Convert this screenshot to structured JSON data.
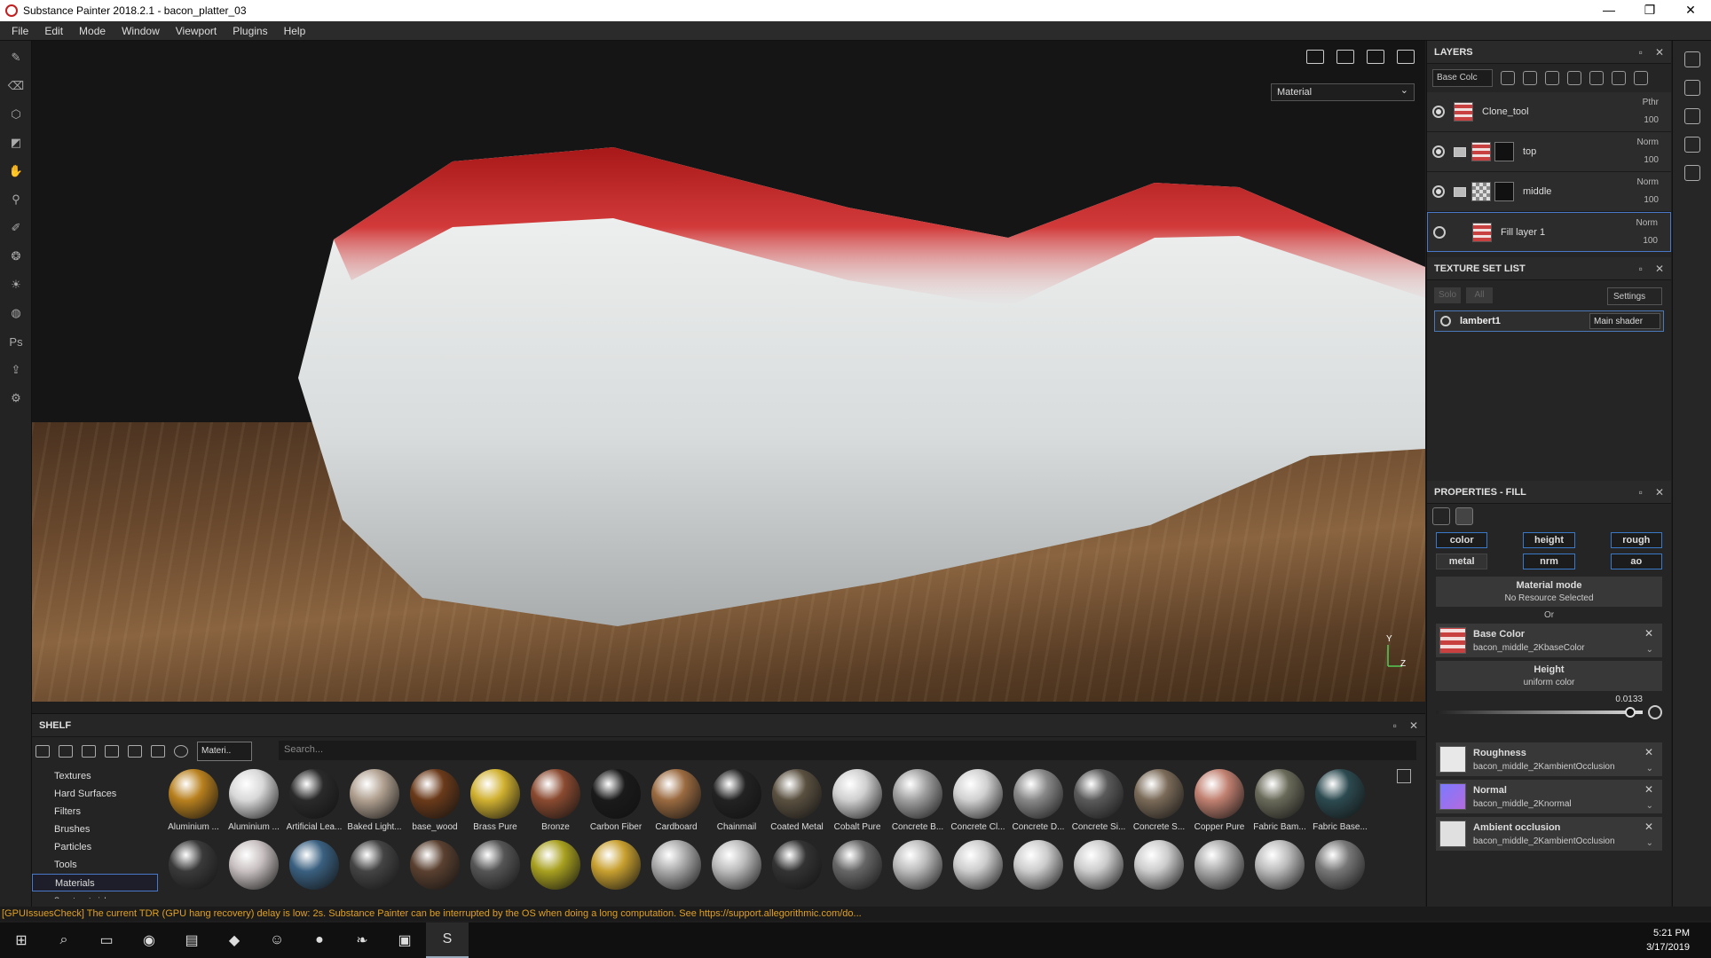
{
  "window": {
    "title": "Substance Painter 2018.2.1 - bacon_platter_03",
    "controls": [
      "—",
      "❐",
      "✕"
    ]
  },
  "menu": [
    "File",
    "Edit",
    "Mode",
    "Window",
    "Viewport",
    "Plugins",
    "Help"
  ],
  "left_tools": [
    "paint-brush-icon",
    "eraser-icon",
    "projection-icon",
    "polygon-fill-icon",
    "smudge-icon",
    "clone-icon",
    "color-picker-icon",
    "scene-icon",
    "light-icon",
    "sphere-icon",
    "photoshop-icon",
    "export-icon",
    "settings-icon"
  ],
  "viewport": {
    "mode_select": "Material",
    "axis_y": "Y",
    "axis_z": "Z"
  },
  "layers": {
    "title": "LAYERS",
    "channel_select": "Base Colc",
    "items": [
      {
        "name": "Clone_tool",
        "blend": "Pthr",
        "opacity": "100",
        "visible": true,
        "folder": false,
        "mask": false
      },
      {
        "name": "top",
        "blend": "Norm",
        "opacity": "100",
        "visible": true,
        "folder": true,
        "mask": true
      },
      {
        "name": "middle",
        "blend": "Norm",
        "opacity": "100",
        "visible": true,
        "folder": true,
        "mask": true
      },
      {
        "name": "Fill layer 1",
        "blend": "Norm",
        "opacity": "100",
        "visible": false,
        "folder": false,
        "mask": false
      }
    ]
  },
  "texture_set": {
    "title": "TEXTURE SET LIST",
    "solo": "Solo",
    "all": "All",
    "settings": "Settings",
    "set_name": "lambert1",
    "shader": "Main shader"
  },
  "properties": {
    "title": "PROPERTIES - FILL",
    "channels": [
      "color",
      "height",
      "rough",
      "metal",
      "nrm",
      "ao"
    ],
    "material_mode": {
      "title": "Material mode",
      "value": "No Resource Selected"
    },
    "or": "Or",
    "base_color": {
      "title": "Base Color",
      "value": "bacon_middle_2KbaseColor"
    },
    "height": {
      "title": "Height",
      "value": "uniform color",
      "number": "0.0133",
      "level": 0.94
    },
    "roughness": {
      "title": "Roughness",
      "value": "bacon_middle_2KambientOcclusion"
    },
    "normal": {
      "title": "Normal",
      "value": "bacon_middle_2Knormal"
    },
    "ao": {
      "title": "Ambient occlusion",
      "value": "bacon_middle_2KambientOcclusion"
    }
  },
  "shelf": {
    "title": "SHELF",
    "filter": "Materi..",
    "search_placeholder": "Search...",
    "categories": [
      "Textures",
      "Hard Surfaces",
      "Filters",
      "Brushes",
      "Particles",
      "Tools",
      "Materials",
      "Smart materials"
    ],
    "active_category": "Materials",
    "materials_row1": [
      "Aluminium ...",
      "Aluminium ...",
      "Artificial Lea...",
      "Baked Light...",
      "base_wood",
      "Brass Pure",
      "Bronze",
      "Carbon Fiber",
      "Cardboard",
      "Chainmail",
      "Coated Metal",
      "Cobalt Pure",
      "Concrete B...",
      "Concrete Cl...",
      "Concrete D...",
      "Concrete Si...",
      "Concrete S...",
      "Copper Pure",
      "Fabric Bam...",
      "Fabric Base..."
    ]
  },
  "status": {
    "warning": "[GPUIssuesCheck] The current TDR (GPU hang recovery) delay is low: 2s. Substance Painter can be interrupted by the OS when doing a long computation. See https://support.allegorithmic.com/do..."
  },
  "taskbar": {
    "apps": [
      "windows-start-icon",
      "search-icon",
      "task-view-icon",
      "chrome-icon",
      "file-explorer-icon",
      "visual-studio-icon",
      "discord-icon",
      "spotify-icon",
      "evernote-icon",
      "trello-icon",
      "substance-painter-icon"
    ],
    "time": "5:21 PM",
    "date": "3/17/2019"
  }
}
